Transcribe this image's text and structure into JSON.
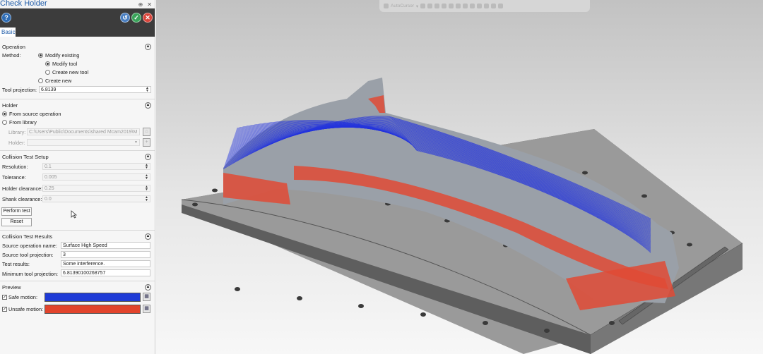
{
  "panel": {
    "title": "Check Holder",
    "pin_icon": "pin-icon",
    "close_glyph": "✕",
    "help_glyph": "?",
    "tab": "Basic",
    "colors": {
      "help": "#2f6db5",
      "ok_apply": "#4a7fc0",
      "ok": "#3aa35a",
      "cancel": "#d9443a"
    }
  },
  "operation": {
    "header": "Operation",
    "method_label": "Method:",
    "modify_existing": "Modify existing",
    "modify_tool": "Modify tool",
    "create_new_tool": "Create new tool",
    "create_new": "Create new",
    "tool_projection_label": "Tool projection:",
    "tool_projection_value": "6.8139"
  },
  "holder": {
    "header": "Holder",
    "from_source": "From source operation",
    "from_library": "From library",
    "library_label": "Library:",
    "library_value": "C:\\Users\\Public\\Documents\\shared Mcam2019\\M",
    "holder_label": "Holder:",
    "holder_value": ""
  },
  "collision_setup": {
    "header": "Collision Test Setup",
    "resolution_label": "Resolution:",
    "resolution_value": "0.1",
    "tolerance_label": "Tolerance:",
    "tolerance_value": "0.005",
    "holder_clearance_label": "Holder clearance:",
    "holder_clearance_value": "0.25",
    "shank_clearance_label": "Shank clearance:",
    "shank_clearance_value": "0.0",
    "perform_test": "Perform test",
    "reset": "Reset"
  },
  "collision_results": {
    "header": "Collision Test Results",
    "source_op_label": "Source operation name:",
    "source_op_value": "Surface High Speed",
    "source_proj_label": "Source tool projection:",
    "source_proj_value": "3",
    "test_results_label": "Test results:",
    "test_results_value": "Some interference.",
    "min_proj_label": "Minimum tool projection:",
    "min_proj_value": "6.81390100268757"
  },
  "preview": {
    "header": "Preview",
    "safe_label": "Safe motion:",
    "safe_color": "#1f3bd6",
    "unsafe_label": "Unsafe motion:",
    "unsafe_color": "#e2442c"
  },
  "viewport": {
    "toolbar_label": "AutoCursor",
    "toolpath_safe": "#2233dd",
    "toolpath_unsafe": "#e04a35"
  }
}
